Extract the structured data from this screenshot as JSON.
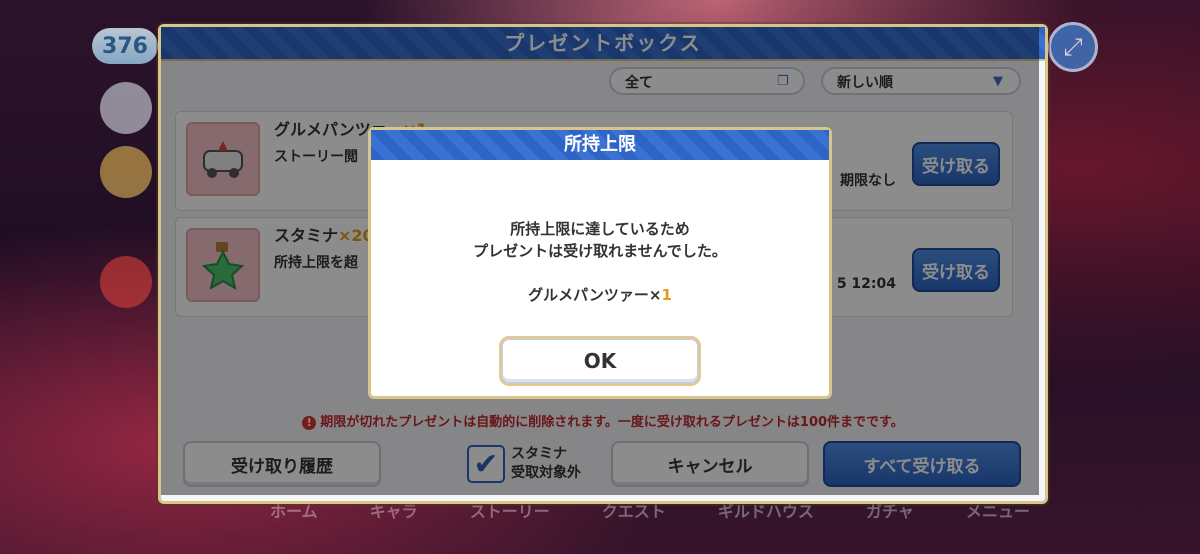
{
  "hud": {
    "count": "376",
    "expand_icon": "expand-arrows-icon"
  },
  "panel": {
    "title": "プレゼントボックス",
    "filter": "全て",
    "sort": "新しい順",
    "items": [
      {
        "name": "グルメパンツァー",
        "qty": "×1",
        "desc": "ストーリー閲",
        "expires": "期限なし",
        "button": "受け取る"
      },
      {
        "name": "スタミナ",
        "qty": "×20",
        "desc": "所持上限を超",
        "expires": "5 12:04",
        "button": "受け取る"
      }
    ],
    "notice": "期限が切れたプレゼントは自動的に削除されます。一度に受け取れるプレゼントは100件までです。",
    "history_button": "受け取り履歴",
    "stamina_checkbox": {
      "line1": "スタミナ",
      "line2": "受取対象外",
      "checked": true
    },
    "cancel_button": "キャンセル",
    "receive_all_button": "すべて受け取る"
  },
  "modal": {
    "title": "所持上限",
    "line1": "所持上限に達しているため",
    "line2": "プレゼントは受け取れませんでした。",
    "item_name": "グルメパンツァー×",
    "item_qty": "1",
    "ok": "OK"
  },
  "bottom_nav": [
    "ホーム",
    "キャラ",
    "ストーリー",
    "クエスト",
    "ギルドハウス",
    "ガチャ",
    "メニュー"
  ]
}
